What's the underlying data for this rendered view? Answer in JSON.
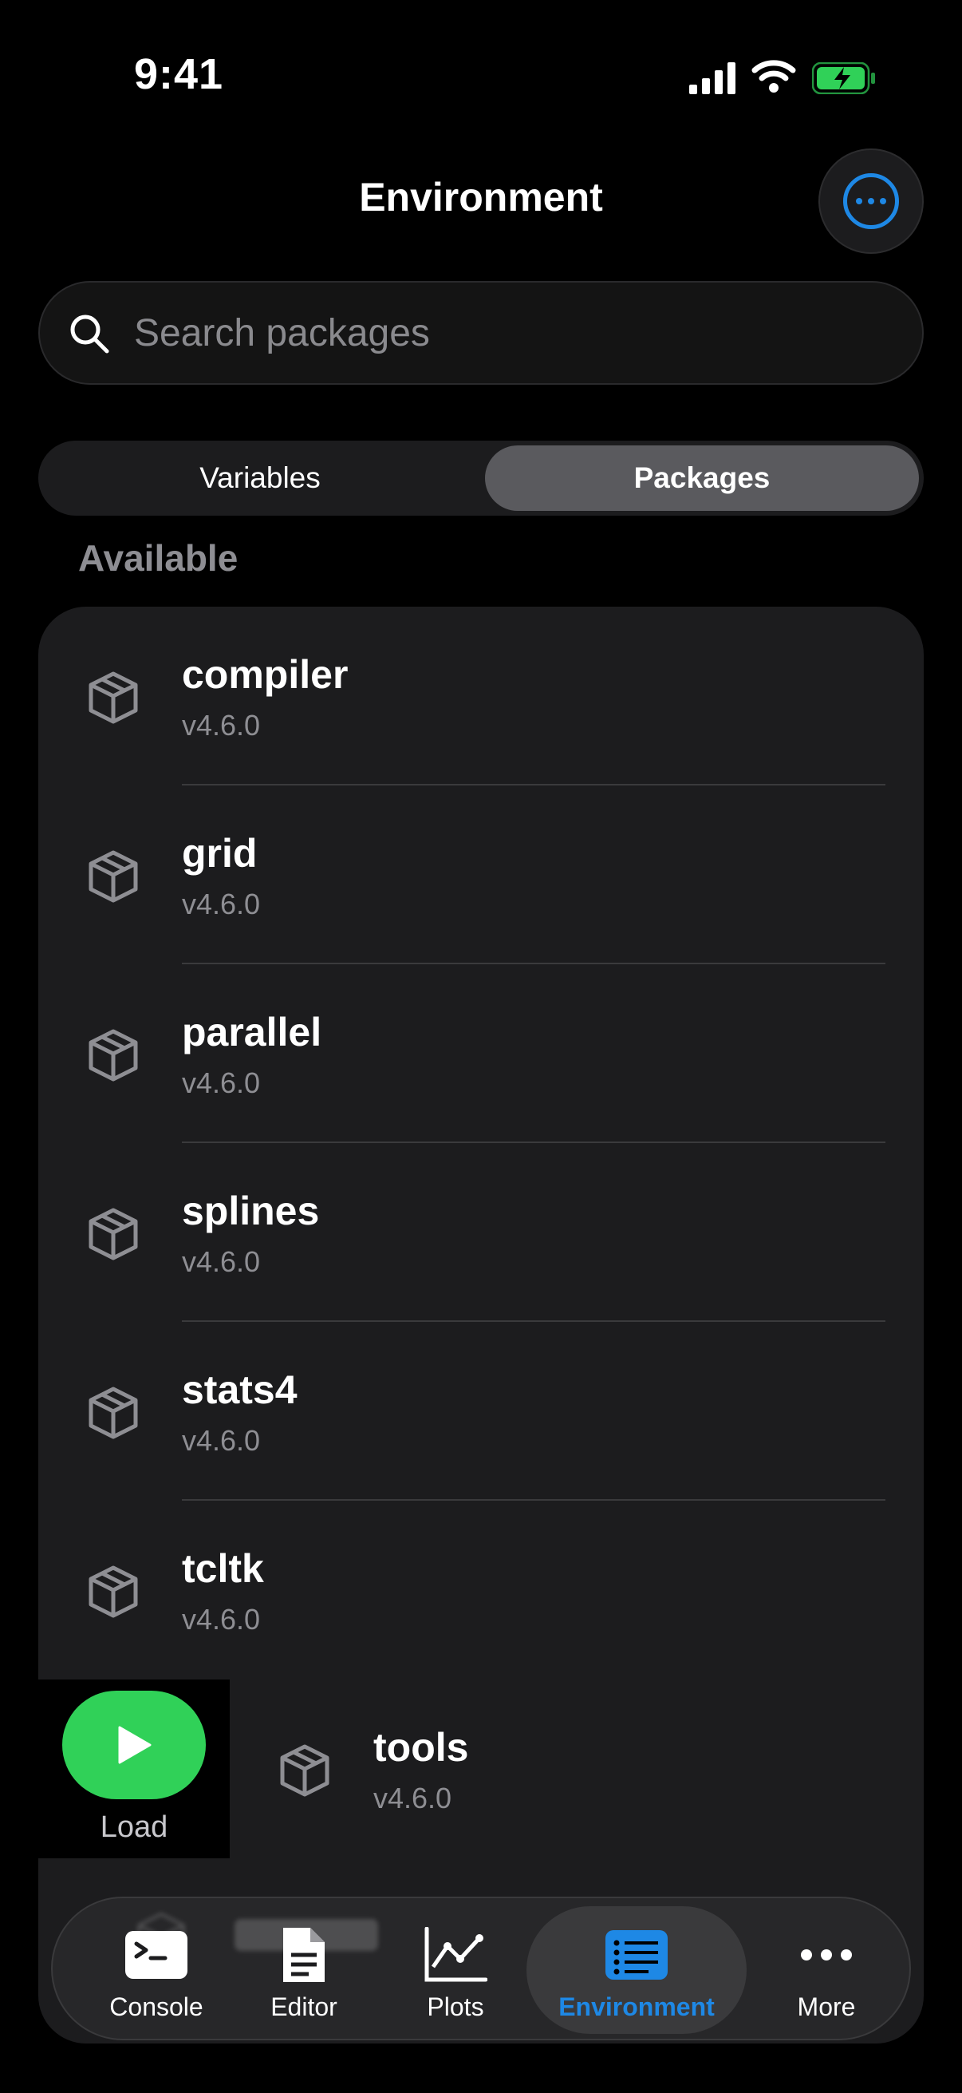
{
  "status_bar": {
    "time": "9:41"
  },
  "header": {
    "title": "Environment"
  },
  "search": {
    "placeholder": "Search packages"
  },
  "segments": {
    "variables": "Variables",
    "packages": "Packages",
    "selected": "Packages"
  },
  "section": {
    "title": "Available"
  },
  "packages": [
    {
      "name": "compiler",
      "version": "v4.6.0"
    },
    {
      "name": "grid",
      "version": "v4.6.0"
    },
    {
      "name": "parallel",
      "version": "v4.6.0"
    },
    {
      "name": "splines",
      "version": "v4.6.0"
    },
    {
      "name": "stats4",
      "version": "v4.6.0"
    },
    {
      "name": "tcltk",
      "version": "v4.6.0"
    },
    {
      "name": "tools",
      "version": "v4.6.0"
    }
  ],
  "swipe_action": {
    "label": "Load",
    "color": "#30d158"
  },
  "tabs": [
    {
      "label": "Console",
      "icon": "terminal-icon"
    },
    {
      "label": "Editor",
      "icon": "document-icon"
    },
    {
      "label": "Plots",
      "icon": "line-chart-icon"
    },
    {
      "label": "Environment",
      "icon": "list-icon",
      "active": true
    },
    {
      "label": "More",
      "icon": "ellipsis-icon"
    }
  ],
  "colors": {
    "accent": "#1e88e5",
    "load": "#30d158",
    "battery": "#30d158"
  }
}
